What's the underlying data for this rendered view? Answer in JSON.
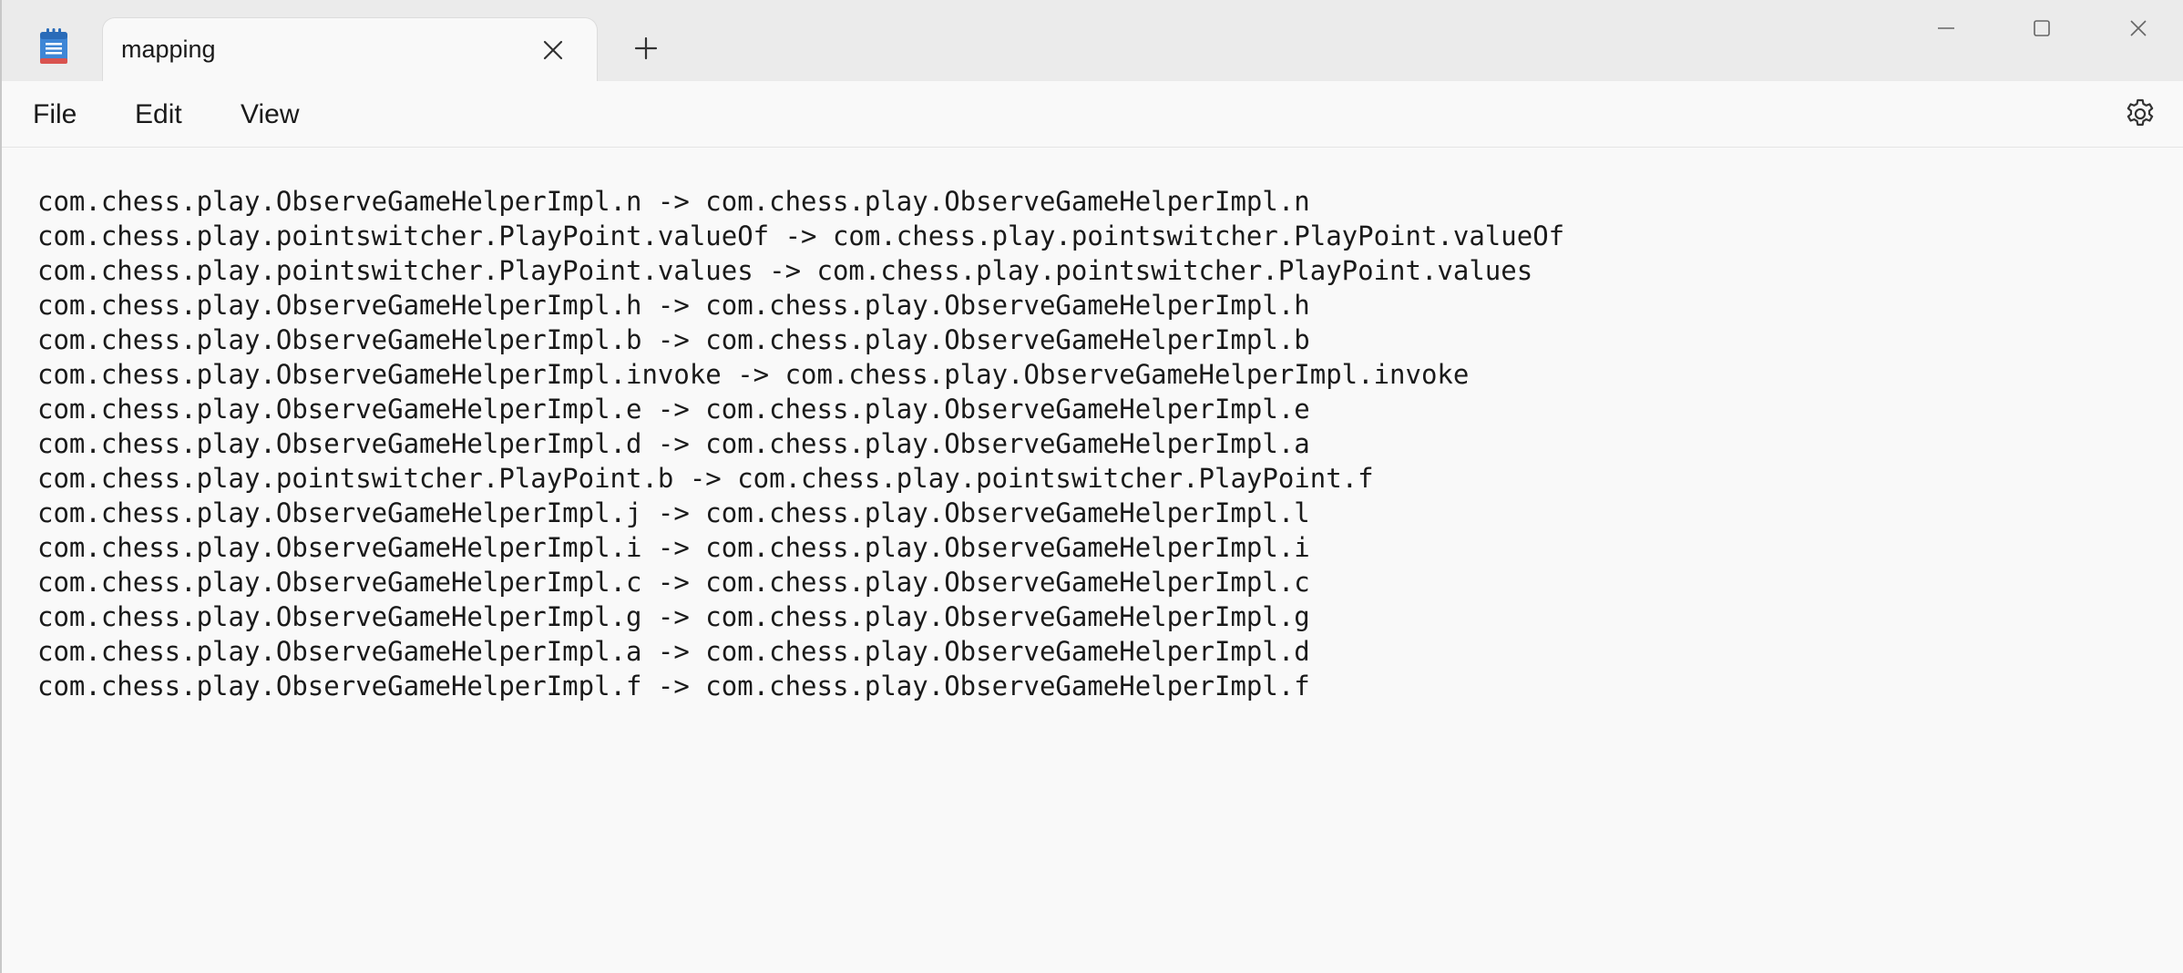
{
  "tab": {
    "title": "mapping"
  },
  "menu": {
    "file": "File",
    "edit": "Edit",
    "view": "View"
  },
  "editor": {
    "lines": [
      "com.chess.play.ObserveGameHelperImpl.n -> com.chess.play.ObserveGameHelperImpl.n",
      "com.chess.play.pointswitcher.PlayPoint.valueOf -> com.chess.play.pointswitcher.PlayPoint.valueOf",
      "com.chess.play.pointswitcher.PlayPoint.values -> com.chess.play.pointswitcher.PlayPoint.values",
      "com.chess.play.ObserveGameHelperImpl.h -> com.chess.play.ObserveGameHelperImpl.h",
      "com.chess.play.ObserveGameHelperImpl.b -> com.chess.play.ObserveGameHelperImpl.b",
      "com.chess.play.ObserveGameHelperImpl.invoke -> com.chess.play.ObserveGameHelperImpl.invoke",
      "com.chess.play.ObserveGameHelperImpl.e -> com.chess.play.ObserveGameHelperImpl.e",
      "com.chess.play.ObserveGameHelperImpl.d -> com.chess.play.ObserveGameHelperImpl.a",
      "com.chess.play.pointswitcher.PlayPoint.b -> com.chess.play.pointswitcher.PlayPoint.f",
      "com.chess.play.ObserveGameHelperImpl.j -> com.chess.play.ObserveGameHelperImpl.l",
      "com.chess.play.ObserveGameHelperImpl.i -> com.chess.play.ObserveGameHelperImpl.i",
      "com.chess.play.ObserveGameHelperImpl.c -> com.chess.play.ObserveGameHelperImpl.c",
      "com.chess.play.ObserveGameHelperImpl.g -> com.chess.play.ObserveGameHelperImpl.g",
      "com.chess.play.ObserveGameHelperImpl.a -> com.chess.play.ObserveGameHelperImpl.d",
      "com.chess.play.ObserveGameHelperImpl.f -> com.chess.play.ObserveGameHelperImpl.f"
    ]
  },
  "icons": {
    "app": "notepad-icon",
    "tab_close": "close-icon",
    "new_tab": "plus-icon",
    "minimize": "minimize-icon",
    "maximize": "maximize-icon",
    "close": "close-icon",
    "settings": "gear-icon"
  },
  "colors": {
    "titlebar": "#ebebeb",
    "surface": "#f9f9f9",
    "text": "#1a1a1a",
    "app_icon_blue": "#2f74c9"
  }
}
